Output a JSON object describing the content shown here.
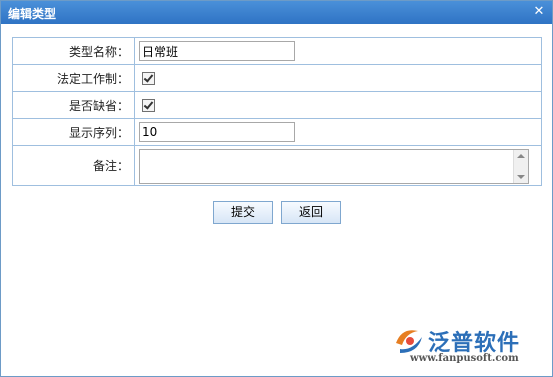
{
  "window": {
    "title": "编辑类型",
    "close": "✕"
  },
  "form": {
    "type_name_label": "类型名称：",
    "type_name_value": "日常班",
    "legal_work_label": "法定工作制：",
    "legal_work_checked": true,
    "is_default_label": "是否缺省：",
    "is_default_checked": true,
    "display_order_label": "显示序列：",
    "display_order_value": "10",
    "remark_label": "备注：",
    "remark_value": ""
  },
  "buttons": {
    "submit": "提交",
    "back": "返回"
  },
  "logo": {
    "text": "泛普软件",
    "url": "www.fanpusoft.com"
  },
  "colors": {
    "titlebar": "#2f73c4",
    "border": "#9fbfdf",
    "logo": "#2c6fb8"
  }
}
